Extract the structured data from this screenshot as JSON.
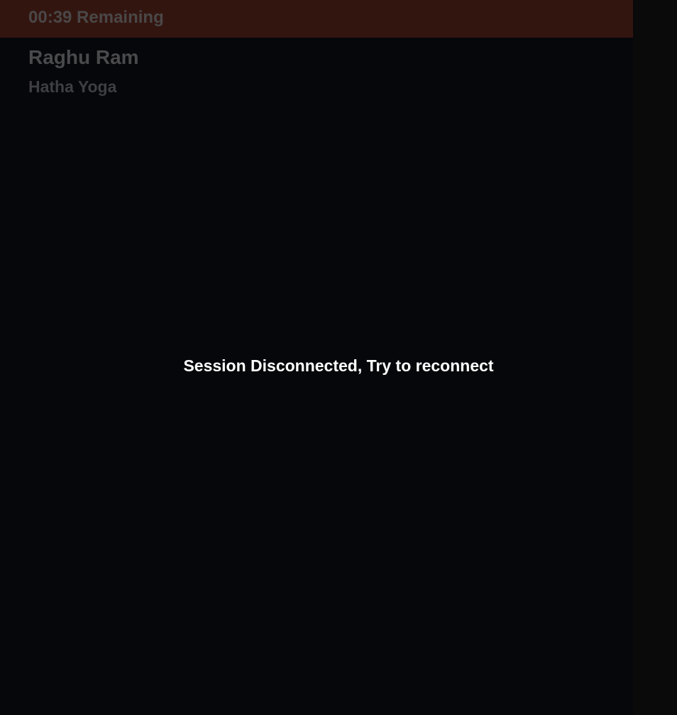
{
  "session": {
    "timer_text": "00:39 Remaining",
    "teacher_name": "Raghu Ram",
    "class_name": "Hatha Yoga",
    "status_message": "Session Disconnected, Try to reconnect"
  },
  "colors": {
    "background": "#06070a",
    "timer_bar": "#331510",
    "status_text": "#ffffff",
    "muted_text": "#4a4a4d"
  }
}
